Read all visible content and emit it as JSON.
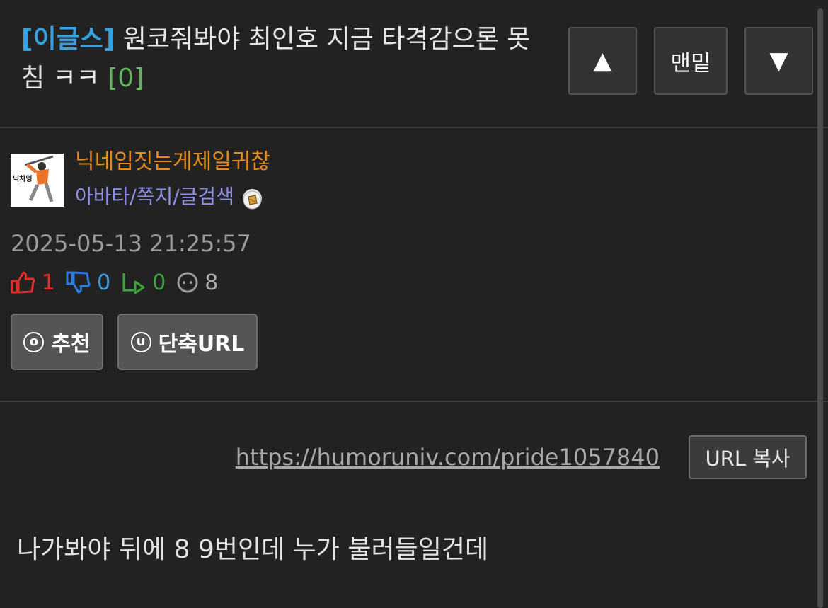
{
  "post": {
    "tag": "[이글스]",
    "title": "원코줘봐야 최인호 지금 타격감으론 못침 ㅋㅋ",
    "comment_count": "[0]"
  },
  "nav": {
    "up_label": "▲",
    "bottom_label": "맨밑",
    "down_label": "▼"
  },
  "author": {
    "avatar_text": "닉차밍",
    "nickname": "닉네임짓는게제일귀찮",
    "links": "아바타/쪽지/글검색"
  },
  "meta": {
    "date": "2025-05-13 21:25:57",
    "likes": "1",
    "dislikes": "0",
    "shares": "0",
    "views": "8"
  },
  "actions": {
    "recommend_icon": "ⓞ",
    "recommend_label": "추천",
    "short_url_icon": "ⓤ",
    "short_url_label": "단축URL"
  },
  "url_box": {
    "url": "https://humoruniv.com/pride1057840",
    "copy_label": "URL 복사"
  },
  "content": {
    "text": "나가봐야 뒤에 8 9번인데 누가 불러들일건데"
  },
  "colors": {
    "background": "#222222",
    "tag": "#35a2e4",
    "comment_count": "#5fb35a",
    "nickname": "#e48a1f",
    "links": "#8f8fe8",
    "like": "#e52b2b",
    "dislike": "#2f7be5",
    "share": "#3aa53a"
  }
}
